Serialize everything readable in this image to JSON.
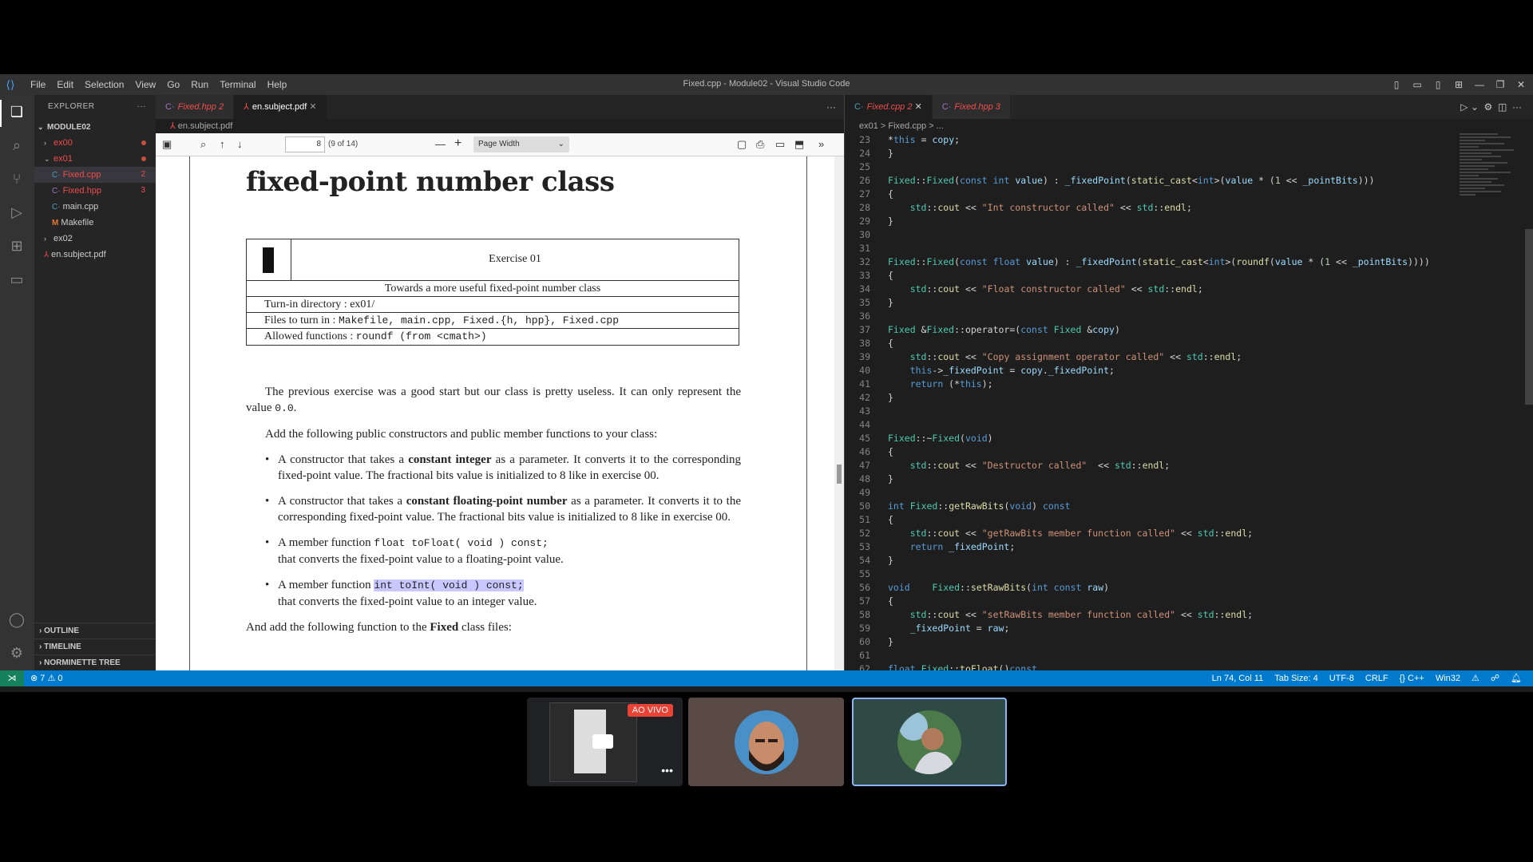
{
  "window": {
    "title": "Fixed.cpp - Module02 - Visual Studio Code",
    "menu": [
      "File",
      "Edit",
      "Selection",
      "View",
      "Go",
      "Run",
      "Terminal",
      "Help"
    ]
  },
  "sidebar": {
    "header": "EXPLORER",
    "root": "MODULE02",
    "items": [
      {
        "label": "ex00"
      },
      {
        "label": "ex01"
      },
      {
        "label": "Fixed.cpp",
        "count": "2"
      },
      {
        "label": "Fixed.hpp",
        "count": "3"
      },
      {
        "label": "main.cpp"
      },
      {
        "label": "Makefile"
      },
      {
        "label": "ex02"
      },
      {
        "label": "en.subject.pdf"
      }
    ],
    "sections": [
      "OUTLINE",
      "TIMELINE",
      "NORMINETTE TREE"
    ]
  },
  "left_tabs": [
    {
      "label": "Fixed.hpp",
      "count": "2"
    },
    {
      "label": "en.subject.pdf"
    }
  ],
  "left_breadcrumb": "en.subject.pdf",
  "pdf_toolbar": {
    "page": "8",
    "page_of": "(9 of 14)",
    "zoom": "Page Width"
  },
  "pdf": {
    "heading": "fixed-point number class",
    "exercise": "Exercise 01",
    "subtitle": "Towards a more useful fixed-point number class",
    "turn_in": "Turn-in directory : ex01/",
    "files_label": "Files to turn in :",
    "files_value": "Makefile, main.cpp, Fixed.{h, hpp}, Fixed.cpp",
    "allowed_label": "Allowed functions :",
    "allowed_value": "roundf (from <cmath>)",
    "p1a": "The previous exercise was a good start but our class is pretty useless. It can only represent the value",
    "p1b": "0.0",
    "p2": "Add the following public constructors and public member functions to your class:",
    "b1a": "A constructor that takes a",
    "b1b": "constant integer",
    "b1c": "as a parameter. It converts it to the corresponding fixed-point value. The fractional bits value is initialized to 8 like in exercise 00.",
    "b2a": "A constructor that takes a",
    "b2b": "constant floating-point number",
    "b2c": "as a parameter. It converts it to the corresponding fixed-point value. The fractional bits value is initialized to 8 like in exercise 00.",
    "b3a": "A member function",
    "b3b": "float toFloat( void ) const;",
    "b3c": "that converts the fixed-point value to a floating-point value.",
    "b4a": "A member function",
    "b4b": "int toInt( void ) const;",
    "b4c": "that converts the fixed-point value to an integer value.",
    "p3a": "And add the following function to the",
    "p3b": "Fixed",
    "p3c": "class files:"
  },
  "right_tabs": [
    {
      "label": "Fixed.cpp",
      "count": "2"
    },
    {
      "label": "Fixed.hpp",
      "count": "3"
    }
  ],
  "right_breadcrumb": "ex01 > Fixed.cpp > ...",
  "code_lines": [
    [
      "23",
      "*this = copy;"
    ],
    [
      "24",
      "}"
    ],
    [
      "25",
      ""
    ],
    [
      "26",
      "Fixed::Fixed(const int value) : _fixedPoint(static_cast<int>(value * (1 << _pointBits)))"
    ],
    [
      "27",
      "{"
    ],
    [
      "28",
      "    std::cout << \"Int constructor called\" << std::endl;"
    ],
    [
      "29",
      "}"
    ],
    [
      "30",
      ""
    ],
    [
      "31",
      ""
    ],
    [
      "32",
      "Fixed::Fixed(const float value) : _fixedPoint(static_cast<int>(roundf(value * (1 << _pointBits))))"
    ],
    [
      "33",
      "{"
    ],
    [
      "34",
      "    std::cout << \"Float constructor called\" << std::endl;"
    ],
    [
      "35",
      "}"
    ],
    [
      "36",
      ""
    ],
    [
      "37",
      "Fixed &Fixed::operator=(const Fixed &copy)"
    ],
    [
      "38",
      "{"
    ],
    [
      "39",
      "    std::cout << \"Copy assignment operator called\" << std::endl;"
    ],
    [
      "40",
      "    this->_fixedPoint = copy._fixedPoint;"
    ],
    [
      "41",
      "    return (*this);"
    ],
    [
      "42",
      "}"
    ],
    [
      "43",
      ""
    ],
    [
      "44",
      ""
    ],
    [
      "45",
      "Fixed::~Fixed(void)"
    ],
    [
      "46",
      "{"
    ],
    [
      "47",
      "    std::cout << \"Destructor called\"  << std::endl;"
    ],
    [
      "48",
      "}"
    ],
    [
      "49",
      ""
    ],
    [
      "50",
      "int Fixed::getRawBits(void) const"
    ],
    [
      "51",
      "{"
    ],
    [
      "52",
      "    std::cout << \"getRawBits member function called\" << std::endl;"
    ],
    [
      "53",
      "    return _fixedPoint;"
    ],
    [
      "54",
      "}"
    ],
    [
      "55",
      ""
    ],
    [
      "56",
      "void    Fixed::setRawBits(int const raw)"
    ],
    [
      "57",
      "{"
    ],
    [
      "58",
      "    std::cout << \"setRawBits member function called\" << std::endl;"
    ],
    [
      "59",
      "    _fixedPoint = raw;"
    ],
    [
      "60",
      "}"
    ],
    [
      "61",
      ""
    ],
    [
      "62",
      "float Fixed::toFloat()const"
    ]
  ],
  "status": {
    "problems": "⊗ 7 ⚠ 0",
    "position": "Ln 74, Col 11",
    "tab_size": "Tab Size: 4",
    "encoding": "UTF-8",
    "eol": "CRLF",
    "language": "{} C++",
    "platform": "Win32"
  },
  "meet": {
    "live_label": "AO VIVO"
  }
}
